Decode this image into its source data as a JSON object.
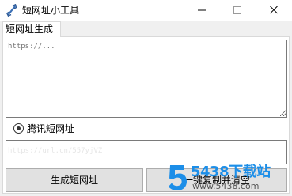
{
  "window": {
    "title": "短网址小工具",
    "icon": "link-icon"
  },
  "tabs": [
    {
      "label": "短网址生成",
      "selected": true
    }
  ],
  "url_input": {
    "placeholder": "https://..."
  },
  "service": {
    "label": "腾讯短网址",
    "checked": true
  },
  "result": {
    "value": "https://url.cn/557yjVZ"
  },
  "buttons": {
    "generate": "生成短网址",
    "copy_clear": "一键复制并清空"
  },
  "watermark": {
    "number": "5",
    "text": "5438下载站",
    "url": "www.5438.com"
  },
  "colors": {
    "watermark_blue": "#1c8ee8",
    "button_bg": "#e1e1e1",
    "client_bg": "#f0f0f0"
  }
}
